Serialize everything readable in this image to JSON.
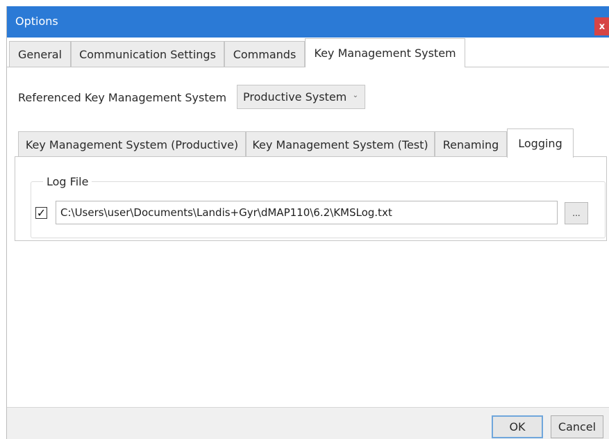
{
  "window": {
    "title": "Options",
    "close_label": "x"
  },
  "tabs": [
    {
      "label": "General",
      "active": false
    },
    {
      "label": "Communication Settings",
      "active": false
    },
    {
      "label": "Commands",
      "active": false
    },
    {
      "label": "Key Management System",
      "active": true
    }
  ],
  "kms": {
    "referenced_label": "Referenced Key Management System",
    "referenced_value": "Productive System"
  },
  "subtabs": [
    {
      "label": "Key Management System (Productive)",
      "active": false
    },
    {
      "label": "Key Management System (Test)",
      "active": false
    },
    {
      "label": "Renaming",
      "active": false
    },
    {
      "label": "Logging",
      "active": true
    }
  ],
  "logging": {
    "group_label": "Log File",
    "enabled": true,
    "check_glyph": "✓",
    "path_value": "C:\\Users\\user\\Documents\\Landis+Gyr\\dMAP110\\6.2\\KMSLog.txt",
    "browse_label": "..."
  },
  "footer": {
    "ok_label": "OK",
    "cancel_label": "Cancel"
  },
  "colors": {
    "titlebar": "#2b7ad6",
    "close_button": "#d64545",
    "ok_border": "#6fa6dc"
  }
}
